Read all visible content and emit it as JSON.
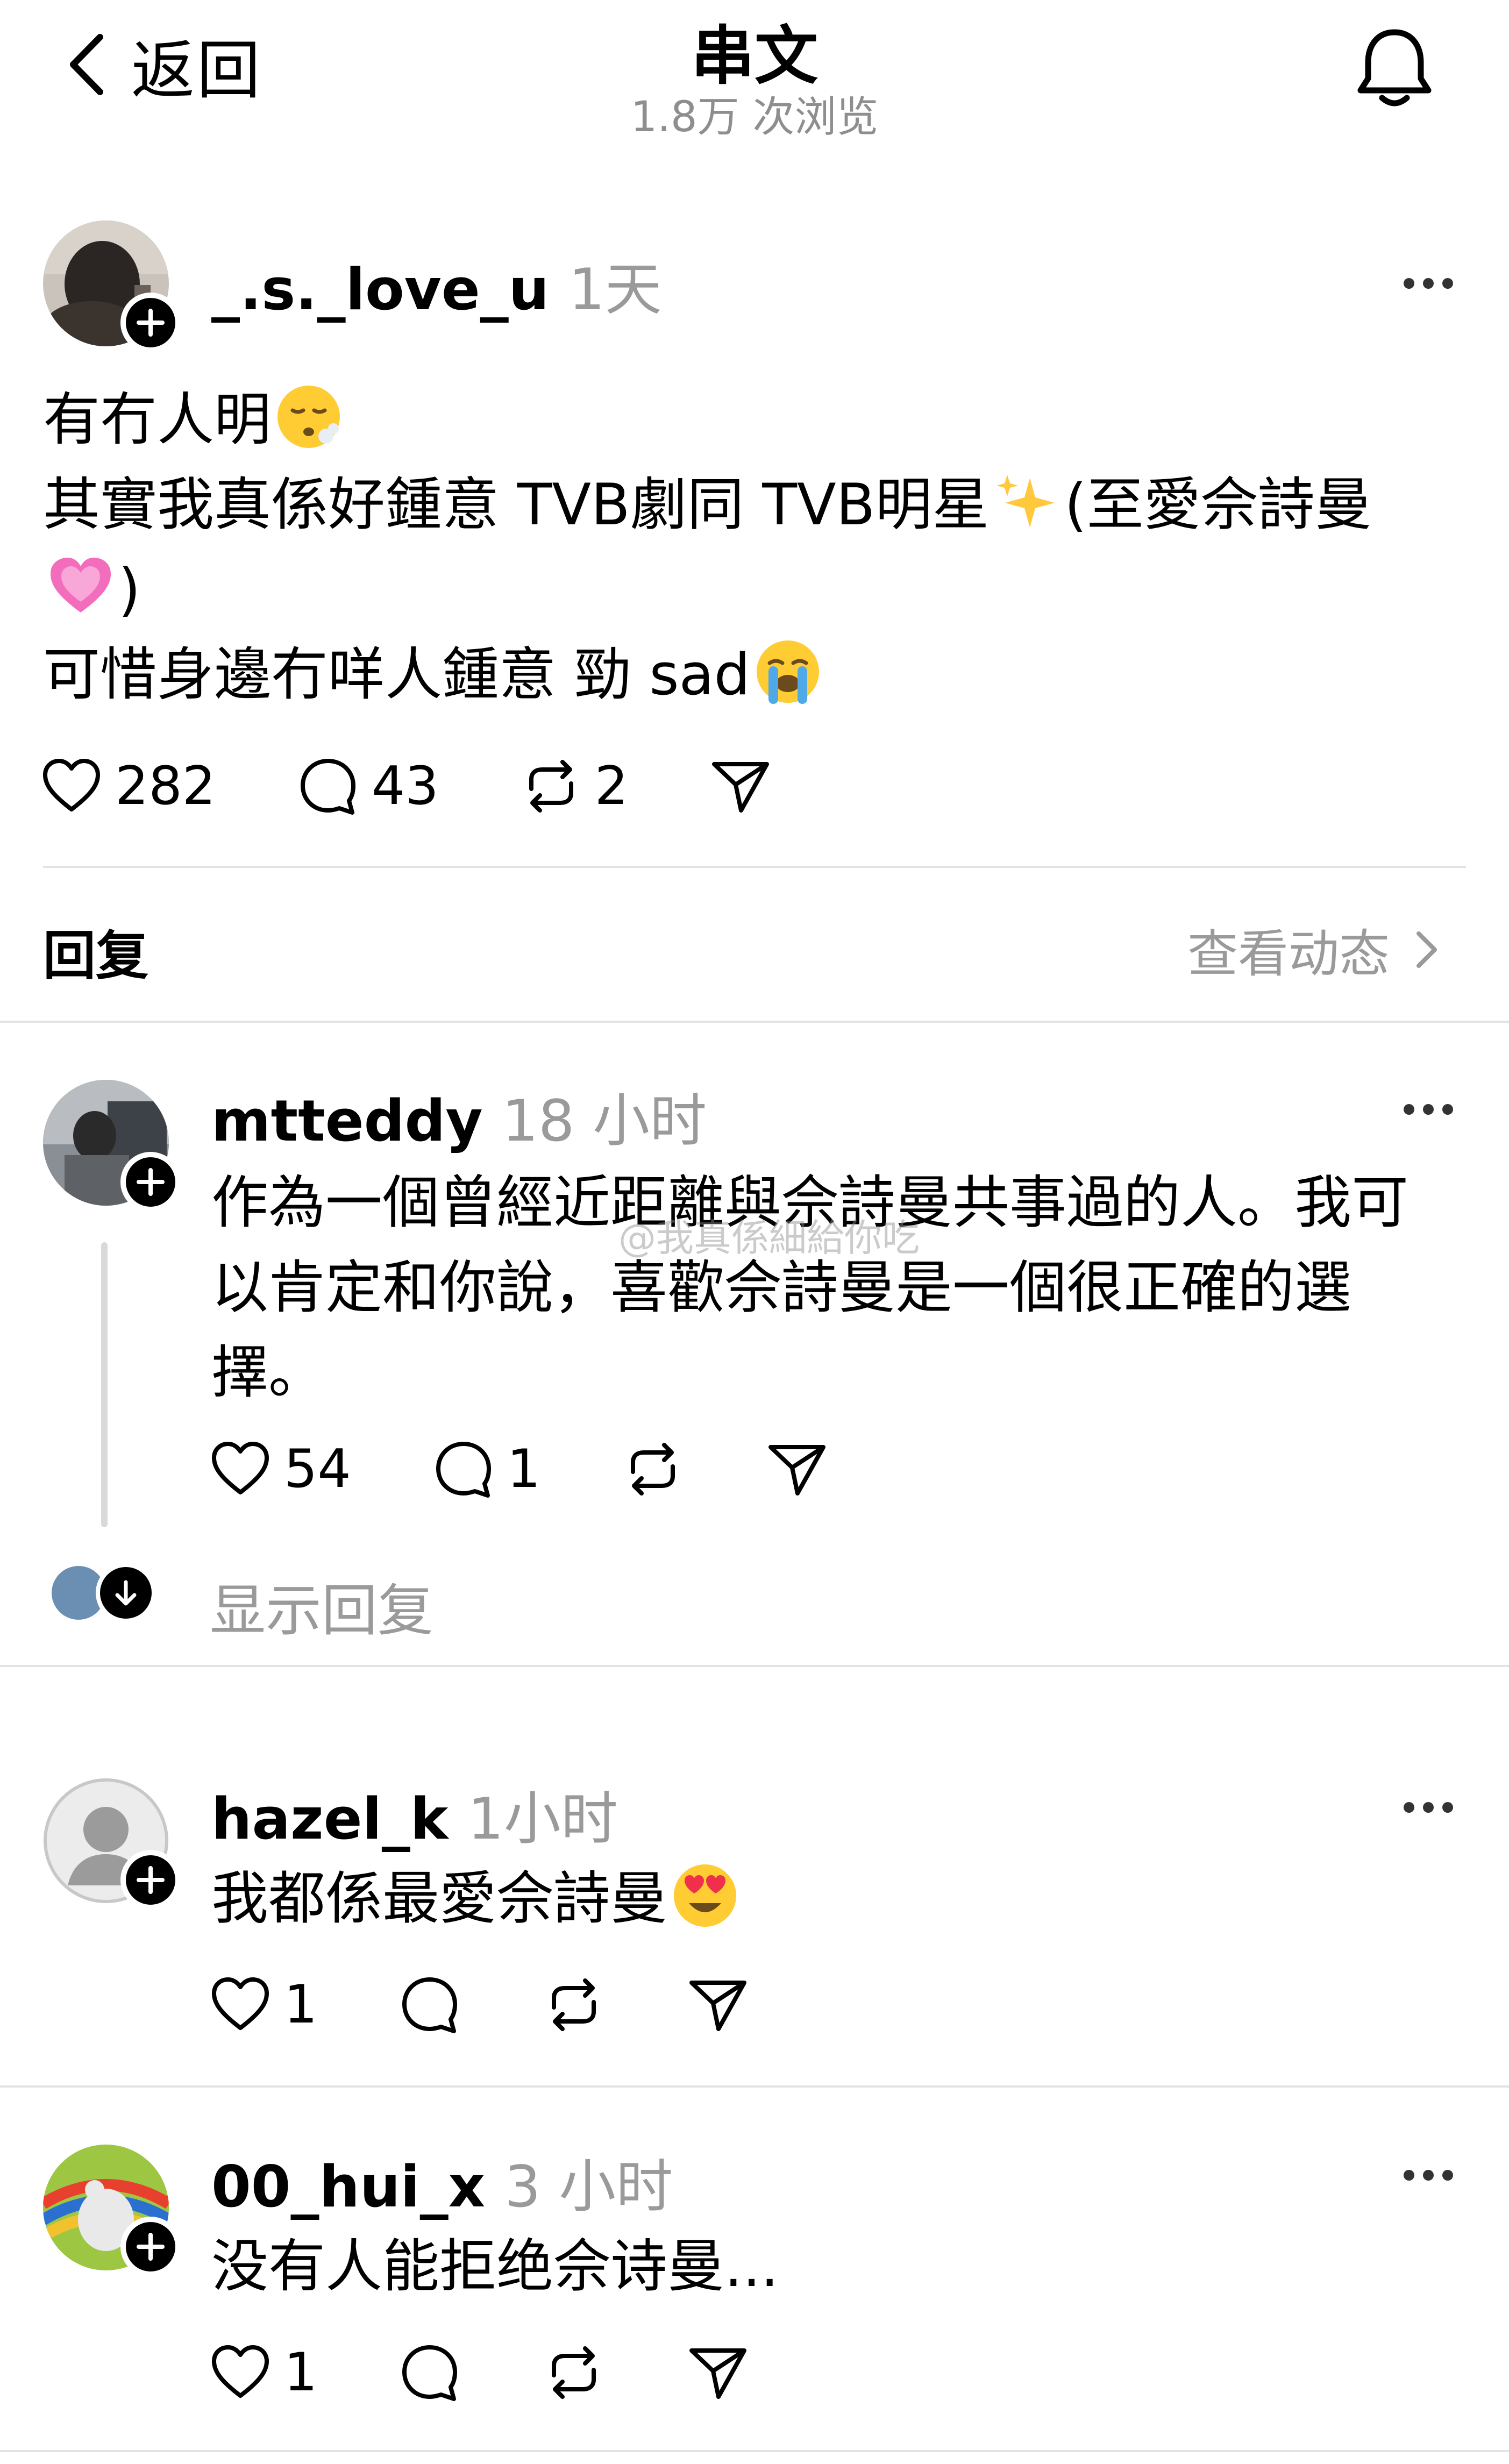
{
  "header": {
    "back_label": "返回",
    "title": "串文",
    "views": "1.8万 次浏览"
  },
  "main_post": {
    "username": "_.s._love_u",
    "time": "1天",
    "lines": [
      "有冇人明",
      "其實我真係好鍾意 TVB劇同 TVB明星",
      "(至愛佘詩曼",
      ")",
      "可惜身邊冇咩人鍾意 勁 sad"
    ],
    "likes": "282",
    "comments": "43",
    "reposts": "2"
  },
  "replies_bar": {
    "label": "回复",
    "activity": "查看动态"
  },
  "replies": [
    {
      "username": "mtteddy",
      "time": "18 小时",
      "lines": [
        "作為一個曾經近距離與佘詩曼共事過的人。我可",
        "以肯定和你說，喜歡佘詩曼是一個很正確的選",
        "擇。"
      ],
      "likes": "54",
      "comments": "1",
      "show_replies": "显示回复"
    },
    {
      "username": "hazel_k",
      "time": "1小时",
      "lines": [
        "我都係最愛佘詩曼"
      ],
      "likes": "1"
    },
    {
      "username": "00_hui_x",
      "time": "3 小时",
      "lines": [
        "没有人能拒绝佘诗曼..."
      ],
      "likes": "1"
    }
  ],
  "watermark": "@我真係細給你吃",
  "colors": {
    "text": "#000000",
    "secondary": "#9a9a9a",
    "divider": "#e3e3e3",
    "background": "#ffffff"
  }
}
